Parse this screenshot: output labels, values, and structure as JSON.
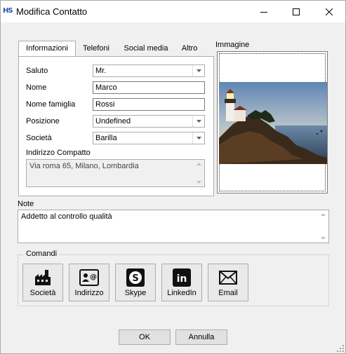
{
  "window": {
    "title": "Modifica Contatto",
    "app_icon_text": "HS"
  },
  "tabs": [
    {
      "label": "Informazioni",
      "active": true
    },
    {
      "label": "Telefoni",
      "active": false
    },
    {
      "label": "Social media",
      "active": false
    },
    {
      "label": "Altro",
      "active": false
    }
  ],
  "form": {
    "saluto_label": "Saluto",
    "saluto_value": "Mr.",
    "nome_label": "Nome",
    "nome_value": "Marco",
    "cognome_label": "Nome famiglia",
    "cognome_value": "Rossi",
    "posizione_label": "Posizione",
    "posizione_value": "Undefined",
    "societa_label": "Società",
    "societa_value": "Barilla",
    "indirizzo_label": "Indirizzo Compatto",
    "indirizzo_value": "Via roma 65, Milano, Lombardia"
  },
  "image": {
    "label": "Immagine",
    "description_colors": {
      "sky_top": "#6f8fb3",
      "sky_bottom": "#e9c18a",
      "rock": "#3a2a1e",
      "sea": "#4a6a8a"
    }
  },
  "notes": {
    "label": "Note",
    "value": "Addetto al controllo qualità"
  },
  "commands": {
    "group_label": "Comandi",
    "buttons": [
      {
        "label": "Società",
        "icon": "factory-icon"
      },
      {
        "label": "Indirizzo",
        "icon": "contact-card-icon"
      },
      {
        "label": "Skype",
        "icon": "skype-icon"
      },
      {
        "label": "LinkedIn",
        "icon": "linkedin-icon"
      },
      {
        "label": "Email",
        "icon": "envelope-icon"
      }
    ]
  },
  "footer": {
    "ok_label": "OK",
    "cancel_label": "Annulla"
  }
}
